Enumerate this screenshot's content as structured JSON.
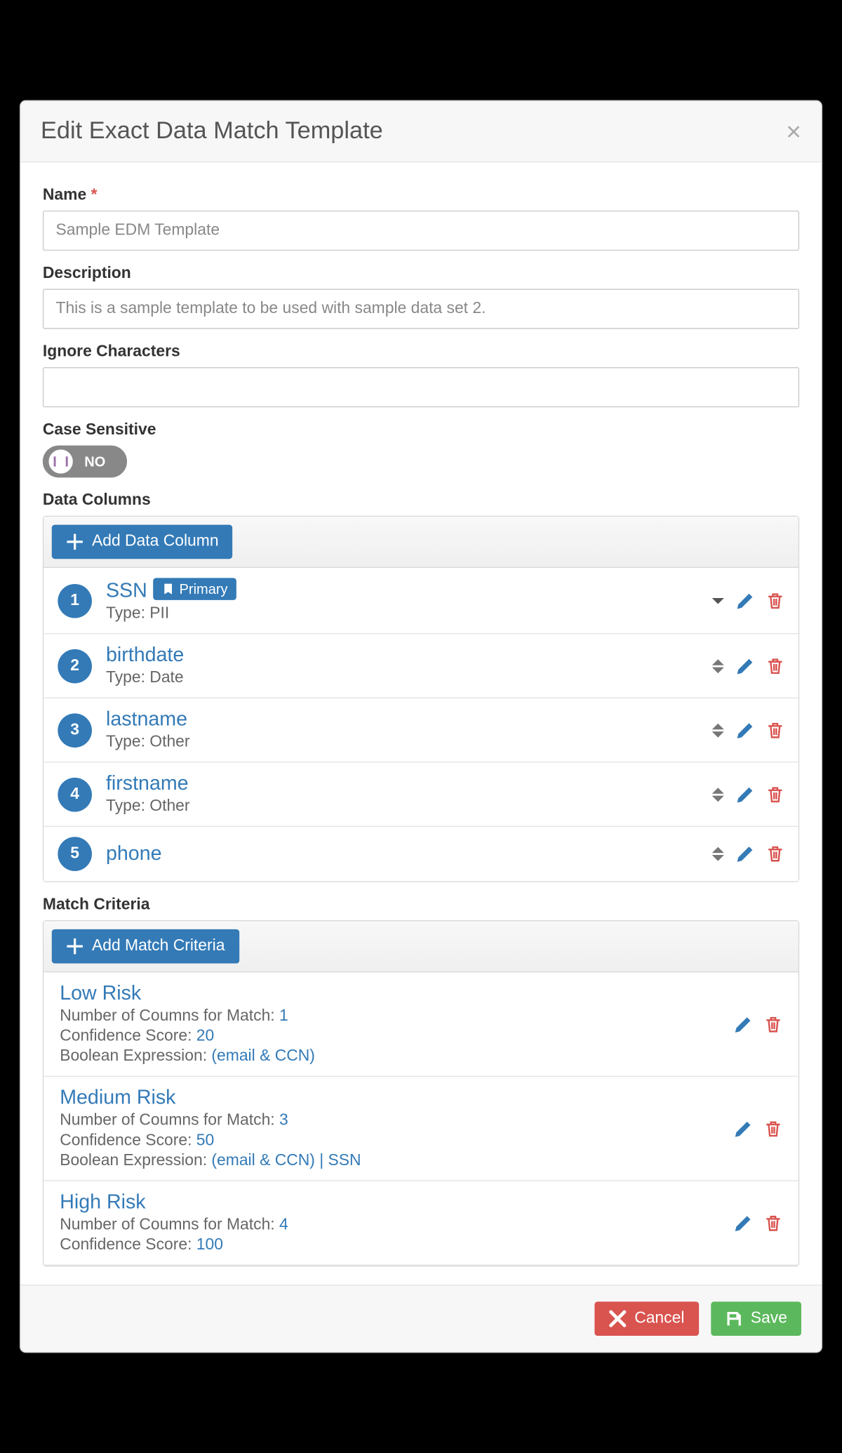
{
  "modal": {
    "title": "Edit Exact Data Match Template",
    "labels": {
      "name": "Name",
      "description": "Description",
      "ignore": "Ignore Characters",
      "caseSensitive": "Case Sensitive",
      "dataColumns": "Data Columns",
      "matchCriteria": "Match Criteria"
    },
    "values": {
      "name": "Sample EDM Template",
      "description": "This is a sample template to be used with sample data set 2.",
      "ignore": ""
    },
    "toggle": {
      "caseSensitive": "NO"
    },
    "buttons": {
      "addDataColumn": "Add Data Column",
      "addMatchCriteria": "Add Match Criteria",
      "cancel": "Cancel",
      "save": "Save"
    },
    "typePrefix": "Type: ",
    "primaryBadge": "Primary",
    "columns": [
      {
        "n": "1",
        "name": "SSN",
        "type": "PII",
        "primary": true,
        "sort": "down-only"
      },
      {
        "n": "2",
        "name": "birthdate",
        "type": "Date",
        "primary": false,
        "sort": "both"
      },
      {
        "n": "3",
        "name": "lastname",
        "type": "Other",
        "primary": false,
        "sort": "both"
      },
      {
        "n": "4",
        "name": "firstname",
        "type": "Other",
        "primary": false,
        "sort": "both"
      },
      {
        "n": "5",
        "name": "phone",
        "type": "",
        "primary": false,
        "sort": "both"
      }
    ],
    "criteriaLabels": {
      "numCols": "Number of Coumns for Match: ",
      "confidence": "Confidence Score: ",
      "boolean": "Boolean Expression: "
    },
    "criteria": [
      {
        "title": "Low Risk",
        "numCols": "1",
        "confidence": "20",
        "boolean": "(email & CCN)"
      },
      {
        "title": "Medium Risk",
        "numCols": "3",
        "confidence": "50",
        "boolean": "(email & CCN) | SSN"
      },
      {
        "title": "High Risk",
        "numCols": "4",
        "confidence": "100",
        "boolean": ""
      }
    ]
  }
}
